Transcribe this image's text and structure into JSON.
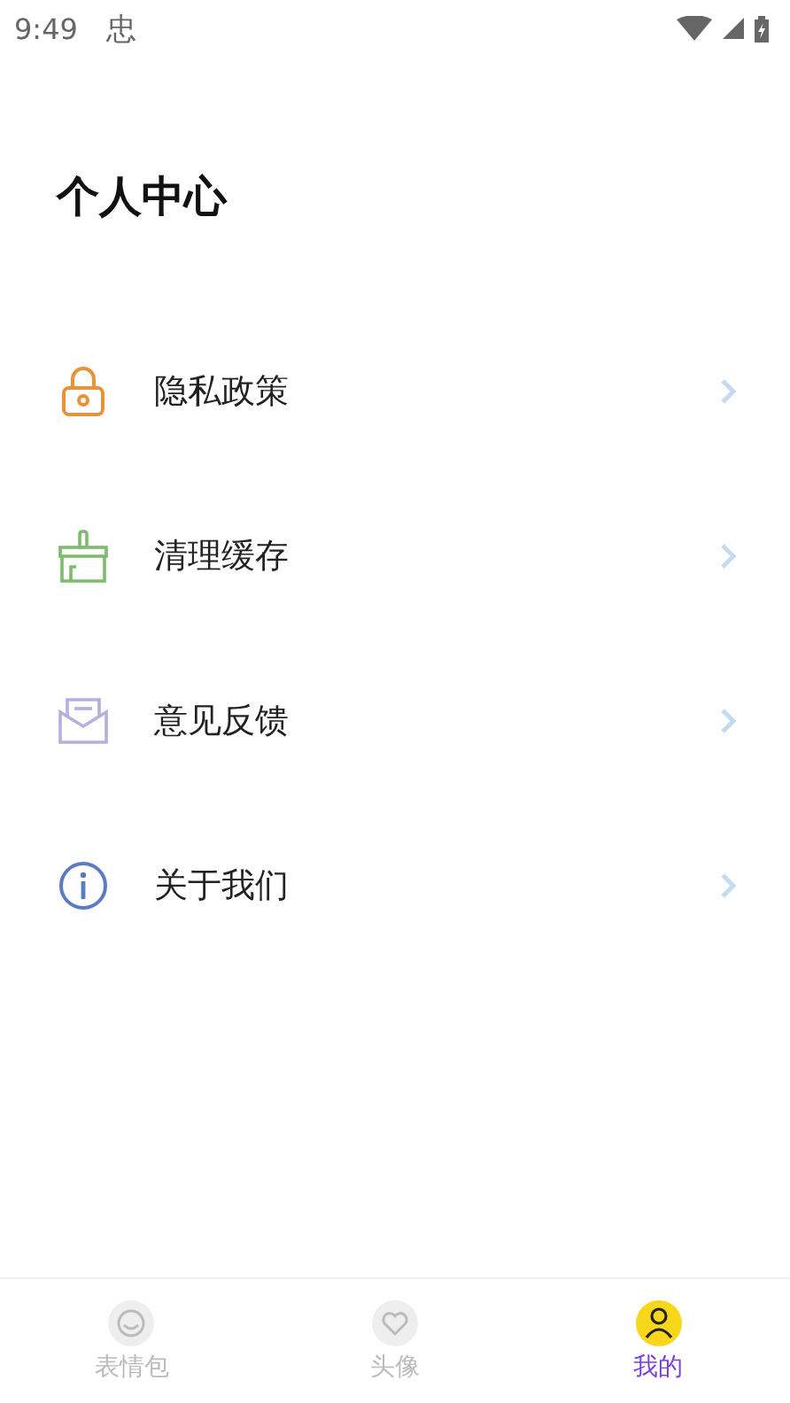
{
  "status_bar": {
    "time": "9:49",
    "notification": "忠"
  },
  "title": "个人中心",
  "menu": [
    {
      "kind": "lock",
      "label": "隐私政策"
    },
    {
      "kind": "broom",
      "label": "清理缓存"
    },
    {
      "kind": "mail",
      "label": "意见反馈"
    },
    {
      "kind": "info",
      "label": "关于我们"
    }
  ],
  "tabs": [
    {
      "kind": "smile",
      "label": "表情包",
      "selected": false
    },
    {
      "kind": "heart",
      "label": "头像",
      "selected": false
    },
    {
      "kind": "person",
      "label": "我的",
      "selected": true
    }
  ]
}
